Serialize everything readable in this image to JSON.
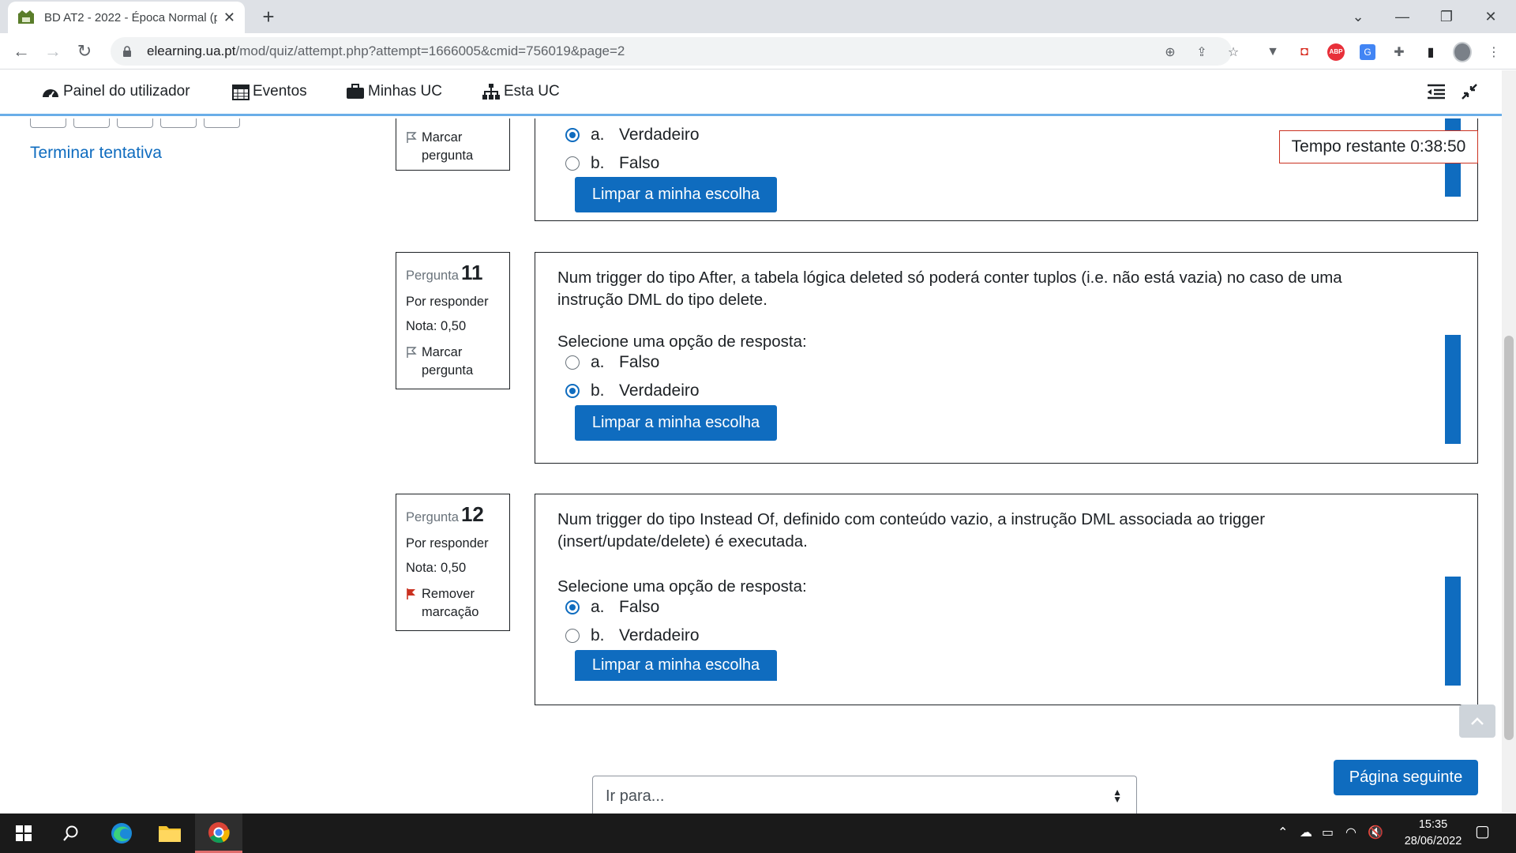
{
  "browser": {
    "tab_title": "BD AT2 - 2022 - Época Normal (p",
    "url_host": "elearning.ua.pt",
    "url_path": "/mod/quiz/attempt.php?attempt=1666005&cmid=756019&page=2",
    "icons": [
      "back-icon",
      "forward-icon",
      "reload-icon",
      "lock-icon",
      "zoom-icon",
      "share-icon",
      "star-icon",
      "extension-icons",
      "profile-avatar",
      "menu-icon"
    ]
  },
  "nav": {
    "dashboard": "Painel do utilizador",
    "events": "Eventos",
    "my_courses": "Minhas UC",
    "this_course": "Esta UC"
  },
  "sidebar": {
    "finish_attempt": "Terminar tentativa"
  },
  "timer": {
    "text": "Tempo restante 0:38:50"
  },
  "questions": [
    {
      "flag_label_1": "Marcar",
      "flag_label_2": "pergunta",
      "options": [
        {
          "letter": "a.",
          "text": "Verdadeiro",
          "checked": true
        },
        {
          "letter": "b.",
          "text": "Falso",
          "checked": false
        }
      ],
      "clear": "Limpar a minha escolha"
    },
    {
      "label": "Pergunta",
      "number": "11",
      "status": "Por responder",
      "grade": "Nota: 0,50",
      "flag_label_1": "Marcar",
      "flag_label_2": "pergunta",
      "text_1": "Num trigger do tipo After, a tabela lógica deleted só poderá conter tuplos (i.e. não está vazia) no caso de uma",
      "text_2": "instrução DML do tipo delete.",
      "prompt": "Selecione uma opção de resposta:",
      "options": [
        {
          "letter": "a.",
          "text": "Falso",
          "checked": false
        },
        {
          "letter": "b.",
          "text": "Verdadeiro",
          "checked": true
        }
      ],
      "clear": "Limpar a minha escolha"
    },
    {
      "label": "Pergunta",
      "number": "12",
      "status": "Por responder",
      "grade": "Nota: 0,50",
      "flag_label_1": "Remover",
      "flag_label_2": "marcação",
      "flag_color": "#ca3120",
      "text_1": "Num trigger do tipo Instead Of, definido com conteúdo vazio, a instrução DML associada ao trigger",
      "text_2": "(insert/update/delete) é executada.",
      "prompt": "Selecione uma opção de resposta:",
      "options": [
        {
          "letter": "a.",
          "text": "Falso",
          "checked": true
        },
        {
          "letter": "b.",
          "text": "Verdadeiro",
          "checked": false
        }
      ],
      "clear": "Limpar a minha escolha"
    }
  ],
  "footer": {
    "next_page": "Página seguinte",
    "jump_placeholder": "Ir para..."
  },
  "taskbar": {
    "time": "15:35",
    "date": "28/06/2022"
  },
  "colors": {
    "accent": "#0f6cbf",
    "timer_border": "#ca3120"
  }
}
